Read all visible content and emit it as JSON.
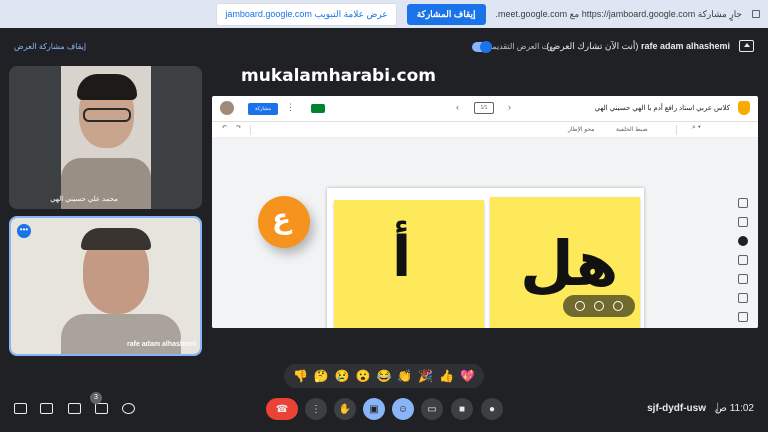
{
  "share_bar": {
    "message": "جارٍ مشاركة https://jamboard.google.com مع meet.google.com.",
    "stop_label": "إيقاف المشاركة",
    "show_label": "عرض علامة التبويب jamboard.google.com"
  },
  "meet_top": {
    "presenter_name": "rafe adam alhashemi",
    "presenter_status": "(أنت الآن تشارك العرض)",
    "audio_label": "صوت العرض التقديمي",
    "stop_presenting": "إيقاف مشاركة العرض"
  },
  "tiles": [
    {
      "name": "محمد علي حسيني الهي"
    },
    {
      "name": "rafe adam alhashemi",
      "more": "•••"
    }
  ],
  "watermark": "mukalamharabi.com",
  "jamboard": {
    "title": "كلاس عربي استاد رافع أدم با الهي حسيني الهي",
    "share_label": "مشاركة",
    "frame_counter": "1/1",
    "tools": {
      "clear": "محو الإطار",
      "background": "ضبط الخلفية"
    },
    "note1": "أ",
    "note2": "هل",
    "logo_letter": "ع"
  },
  "reactions": [
    "👎",
    "🤔",
    "😢",
    "😮",
    "😂",
    "👏",
    "🎉",
    "👍",
    "💖"
  ],
  "bottom": {
    "time": "11:02 ص",
    "separator": "|",
    "meeting_code": "sjf-dydf-usw",
    "participants_count": "3"
  },
  "colors": {
    "accent": "#1a73e8",
    "hangup": "#ea4335",
    "sticky": "#fde95a",
    "bg": "#202124"
  }
}
